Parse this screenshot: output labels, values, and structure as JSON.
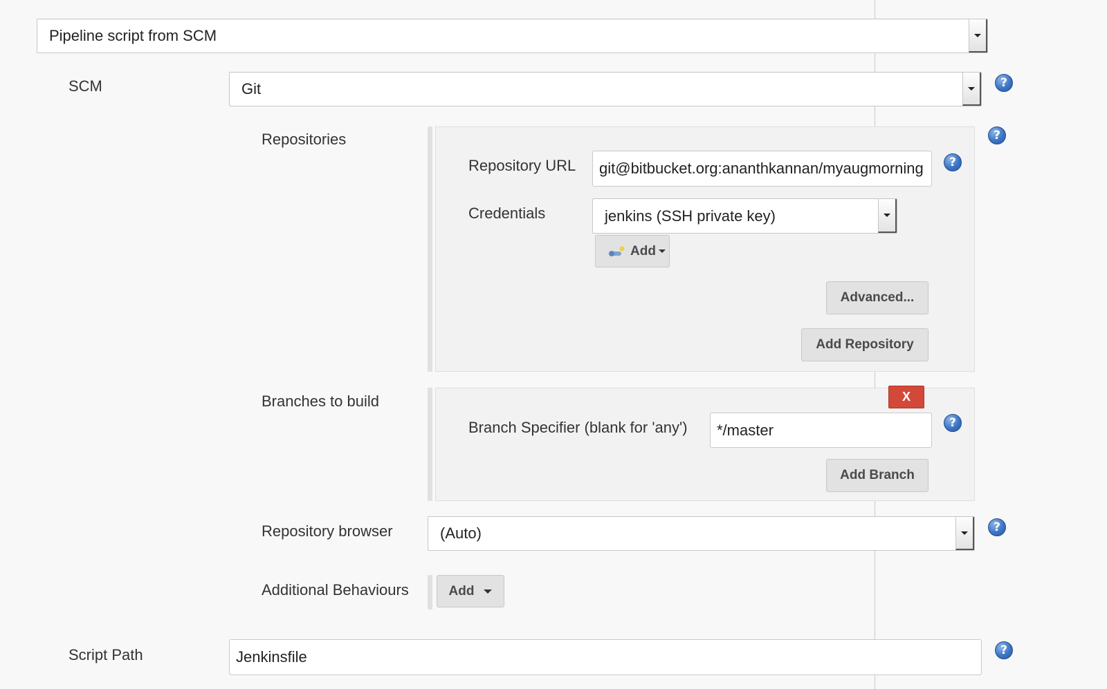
{
  "definition": {
    "selected": "Pipeline script from SCM"
  },
  "scm": {
    "label": "SCM",
    "selected": "Git"
  },
  "repositories": {
    "label": "Repositories",
    "url_label": "Repository URL",
    "url_value": "git@bitbucket.org:ananthkannan/myaugmorning",
    "credentials_label": "Credentials",
    "credentials_selected": "jenkins (SSH private key)",
    "add_label": "Add",
    "advanced_label": "Advanced...",
    "add_repository_label": "Add Repository"
  },
  "branches": {
    "label": "Branches to build",
    "delete_label": "X",
    "specifier_label": "Branch Specifier (blank for 'any')",
    "specifier_value": "*/master",
    "add_branch_label": "Add Branch"
  },
  "repo_browser": {
    "label": "Repository browser",
    "selected": "(Auto)"
  },
  "behaviours": {
    "label": "Additional Behaviours",
    "add_label": "Add"
  },
  "script_path": {
    "label": "Script Path",
    "value": "Jenkinsfile"
  },
  "help_glyph": "?",
  "icons": {
    "help": "help-question-icon",
    "credentials_add": "key-icon"
  },
  "colors": {
    "delete_button": "#d24939",
    "help_icon": "#3c74c4"
  }
}
